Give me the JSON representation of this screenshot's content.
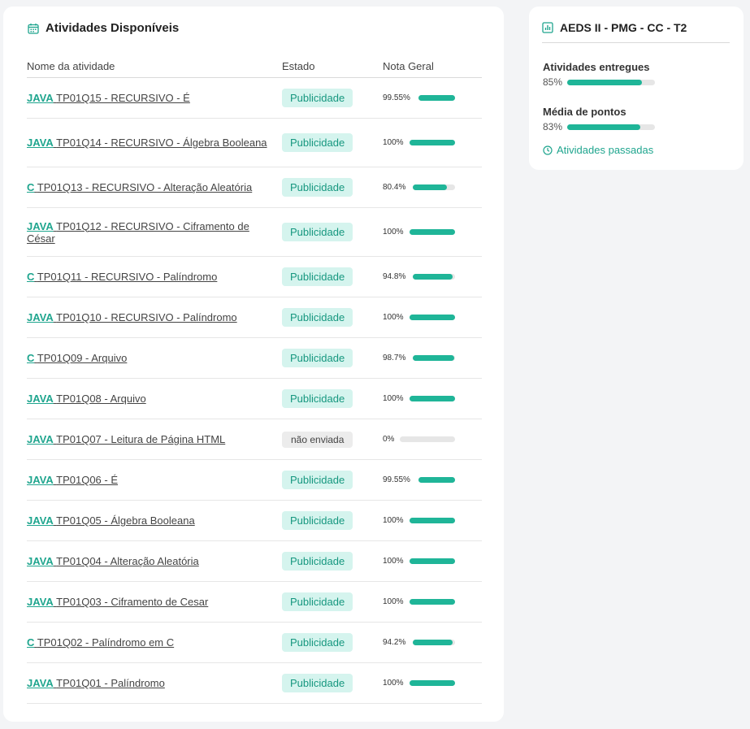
{
  "main": {
    "title": "Atividades Disponíveis",
    "columns": {
      "name": "Nome da atividade",
      "estado": "Estado",
      "nota": "Nota Geral"
    },
    "rows": [
      {
        "lang": "JAVA",
        "name": "TP01Q15 - RECURSIVO - É",
        "status": "Publicidade",
        "pending": false,
        "pct_label": "99.55%",
        "pct": 99.55,
        "tall": false
      },
      {
        "lang": "JAVA",
        "name": "TP01Q14 - RECURSIVO - Álgebra Booleana",
        "status": "Publicidade",
        "pending": false,
        "pct_label": "100%",
        "pct": 100,
        "tall": true
      },
      {
        "lang": "C",
        "name": "TP01Q13 - RECURSIVO - Alteração Aleatória",
        "status": "Publicidade",
        "pending": false,
        "pct_label": "80.4%",
        "pct": 80.4,
        "tall": false
      },
      {
        "lang": "JAVA",
        "name": "TP01Q12 - RECURSIVO - Ciframento de César",
        "status": "Publicidade",
        "pending": false,
        "pct_label": "100%",
        "pct": 100,
        "tall": true
      },
      {
        "lang": "C",
        "name": "TP01Q11 - RECURSIVO - Palíndromo",
        "status": "Publicidade",
        "pending": false,
        "pct_label": "94.8%",
        "pct": 94.8,
        "tall": false
      },
      {
        "lang": "JAVA",
        "name": "TP01Q10 - RECURSIVO - Palíndromo",
        "status": "Publicidade",
        "pending": false,
        "pct_label": "100%",
        "pct": 100,
        "tall": false
      },
      {
        "lang": "C",
        "name": "TP01Q09 - Arquivo",
        "status": "Publicidade",
        "pending": false,
        "pct_label": "98.7%",
        "pct": 98.7,
        "tall": false
      },
      {
        "lang": "JAVA",
        "name": "TP01Q08 - Arquivo",
        "status": "Publicidade",
        "pending": false,
        "pct_label": "100%",
        "pct": 100,
        "tall": false
      },
      {
        "lang": "JAVA",
        "name": "TP01Q07 - Leitura de Página HTML",
        "status": "não enviada",
        "pending": true,
        "pct_label": "0%",
        "pct": 0,
        "tall": false
      },
      {
        "lang": "JAVA",
        "name": "TP01Q06 - É",
        "status": "Publicidade",
        "pending": false,
        "pct_label": "99.55%",
        "pct": 99.55,
        "tall": false
      },
      {
        "lang": "JAVA",
        "name": "TP01Q05 - Álgebra Booleana",
        "status": "Publicidade",
        "pending": false,
        "pct_label": "100%",
        "pct": 100,
        "tall": false
      },
      {
        "lang": "JAVA",
        "name": "TP01Q04 - Alteração Aleatória",
        "status": "Publicidade",
        "pending": false,
        "pct_label": "100%",
        "pct": 100,
        "tall": false
      },
      {
        "lang": "JAVA",
        "name": "TP01Q03 - Ciframento de Cesar",
        "status": "Publicidade",
        "pending": false,
        "pct_label": "100%",
        "pct": 100,
        "tall": false
      },
      {
        "lang": "C",
        "name": "TP01Q02 - Palíndromo em C",
        "status": "Publicidade",
        "pending": false,
        "pct_label": "94.2%",
        "pct": 94.2,
        "tall": false
      },
      {
        "lang": "JAVA",
        "name": "TP01Q01 - Palíndromo",
        "status": "Publicidade",
        "pending": false,
        "pct_label": "100%",
        "pct": 100,
        "tall": false
      }
    ]
  },
  "side": {
    "title": "AEDS II - PMG - CC - T2",
    "delivered": {
      "label": "Atividades entregues",
      "pct_label": "85%",
      "pct": 85
    },
    "average": {
      "label": "Média de pontos",
      "pct_label": "83%",
      "pct": 83
    },
    "past_link": "Atividades passadas"
  },
  "colors": {
    "accent": "#1fb598",
    "accent_text": "#1fa58e",
    "badge_bg": "#d5f4ee",
    "track": "#e6e6e6"
  },
  "icons": {
    "main_title": "calendar-icon",
    "side_title": "bar-chart-icon",
    "past_link": "clock-icon"
  }
}
